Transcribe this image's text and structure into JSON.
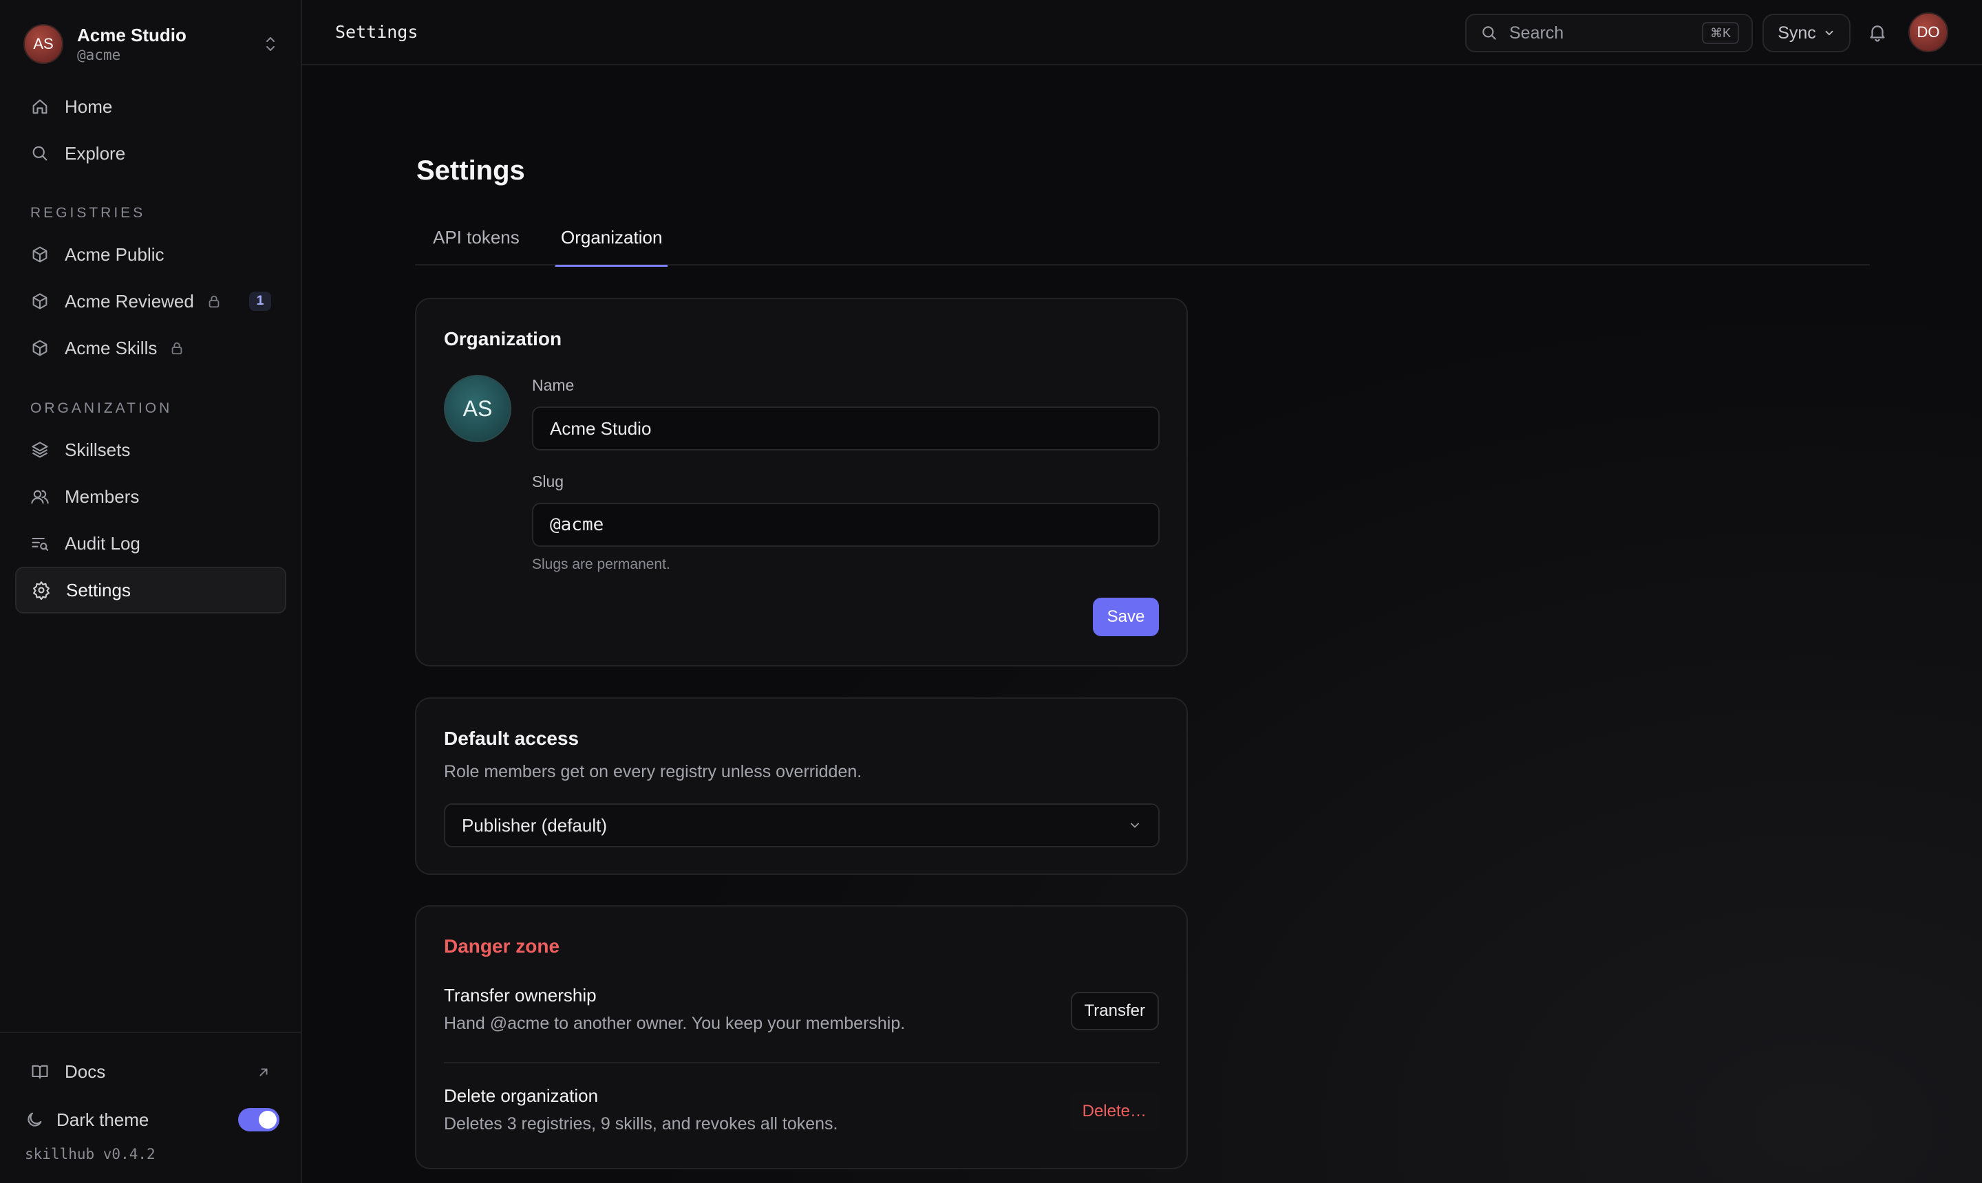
{
  "org": {
    "initials": "AS",
    "name": "Acme Studio",
    "handle": "@acme"
  },
  "nav": {
    "home": "Home",
    "explore": "Explore",
    "registries_label": "Registries",
    "registries": [
      {
        "label": "Acme Public"
      },
      {
        "label": "Acme Reviewed",
        "badge": "1"
      },
      {
        "label": "Acme Skills"
      }
    ],
    "organization_label": "Organization",
    "organization": [
      {
        "label": "Skillsets"
      },
      {
        "label": "Members"
      },
      {
        "label": "Audit Log"
      },
      {
        "label": "Settings"
      }
    ],
    "docs": "Docs",
    "dark_theme": "Dark theme",
    "dark_theme_on": true,
    "version": "skillhub v0.4.2"
  },
  "topbar": {
    "breadcrumb": "Settings",
    "search_label": "Search",
    "search_shortcut": "⌘K",
    "sync_label": "Sync",
    "user_initials": "DO"
  },
  "page": {
    "title": "Settings",
    "tabs": [
      {
        "label": "API tokens",
        "active": false
      },
      {
        "label": "Organization",
        "active": true
      }
    ]
  },
  "org_card": {
    "title": "Organization",
    "avatar_initials": "AS",
    "name_label": "Name",
    "name_value": "Acme Studio",
    "slug_label": "Slug",
    "slug_value": "@acme",
    "slug_hint": "Slugs are permanent.",
    "save_label": "Save"
  },
  "default_access": {
    "title": "Default access",
    "description": "Role members get on every registry unless overridden.",
    "selected": "Publisher (default)"
  },
  "danger_zone": {
    "title": "Danger zone",
    "transfer_title": "Transfer ownership",
    "transfer_desc": "Hand @acme to another owner. You keep your membership.",
    "transfer_button": "Transfer",
    "delete_title": "Delete organization",
    "delete_desc": "Deletes 3 registries, 9 skills, and revokes all tokens.",
    "delete_button": "Delete…"
  },
  "colors": {
    "accent": "#6b6ef5",
    "danger": "#ef5f5f",
    "background": "#0b0b0d"
  }
}
